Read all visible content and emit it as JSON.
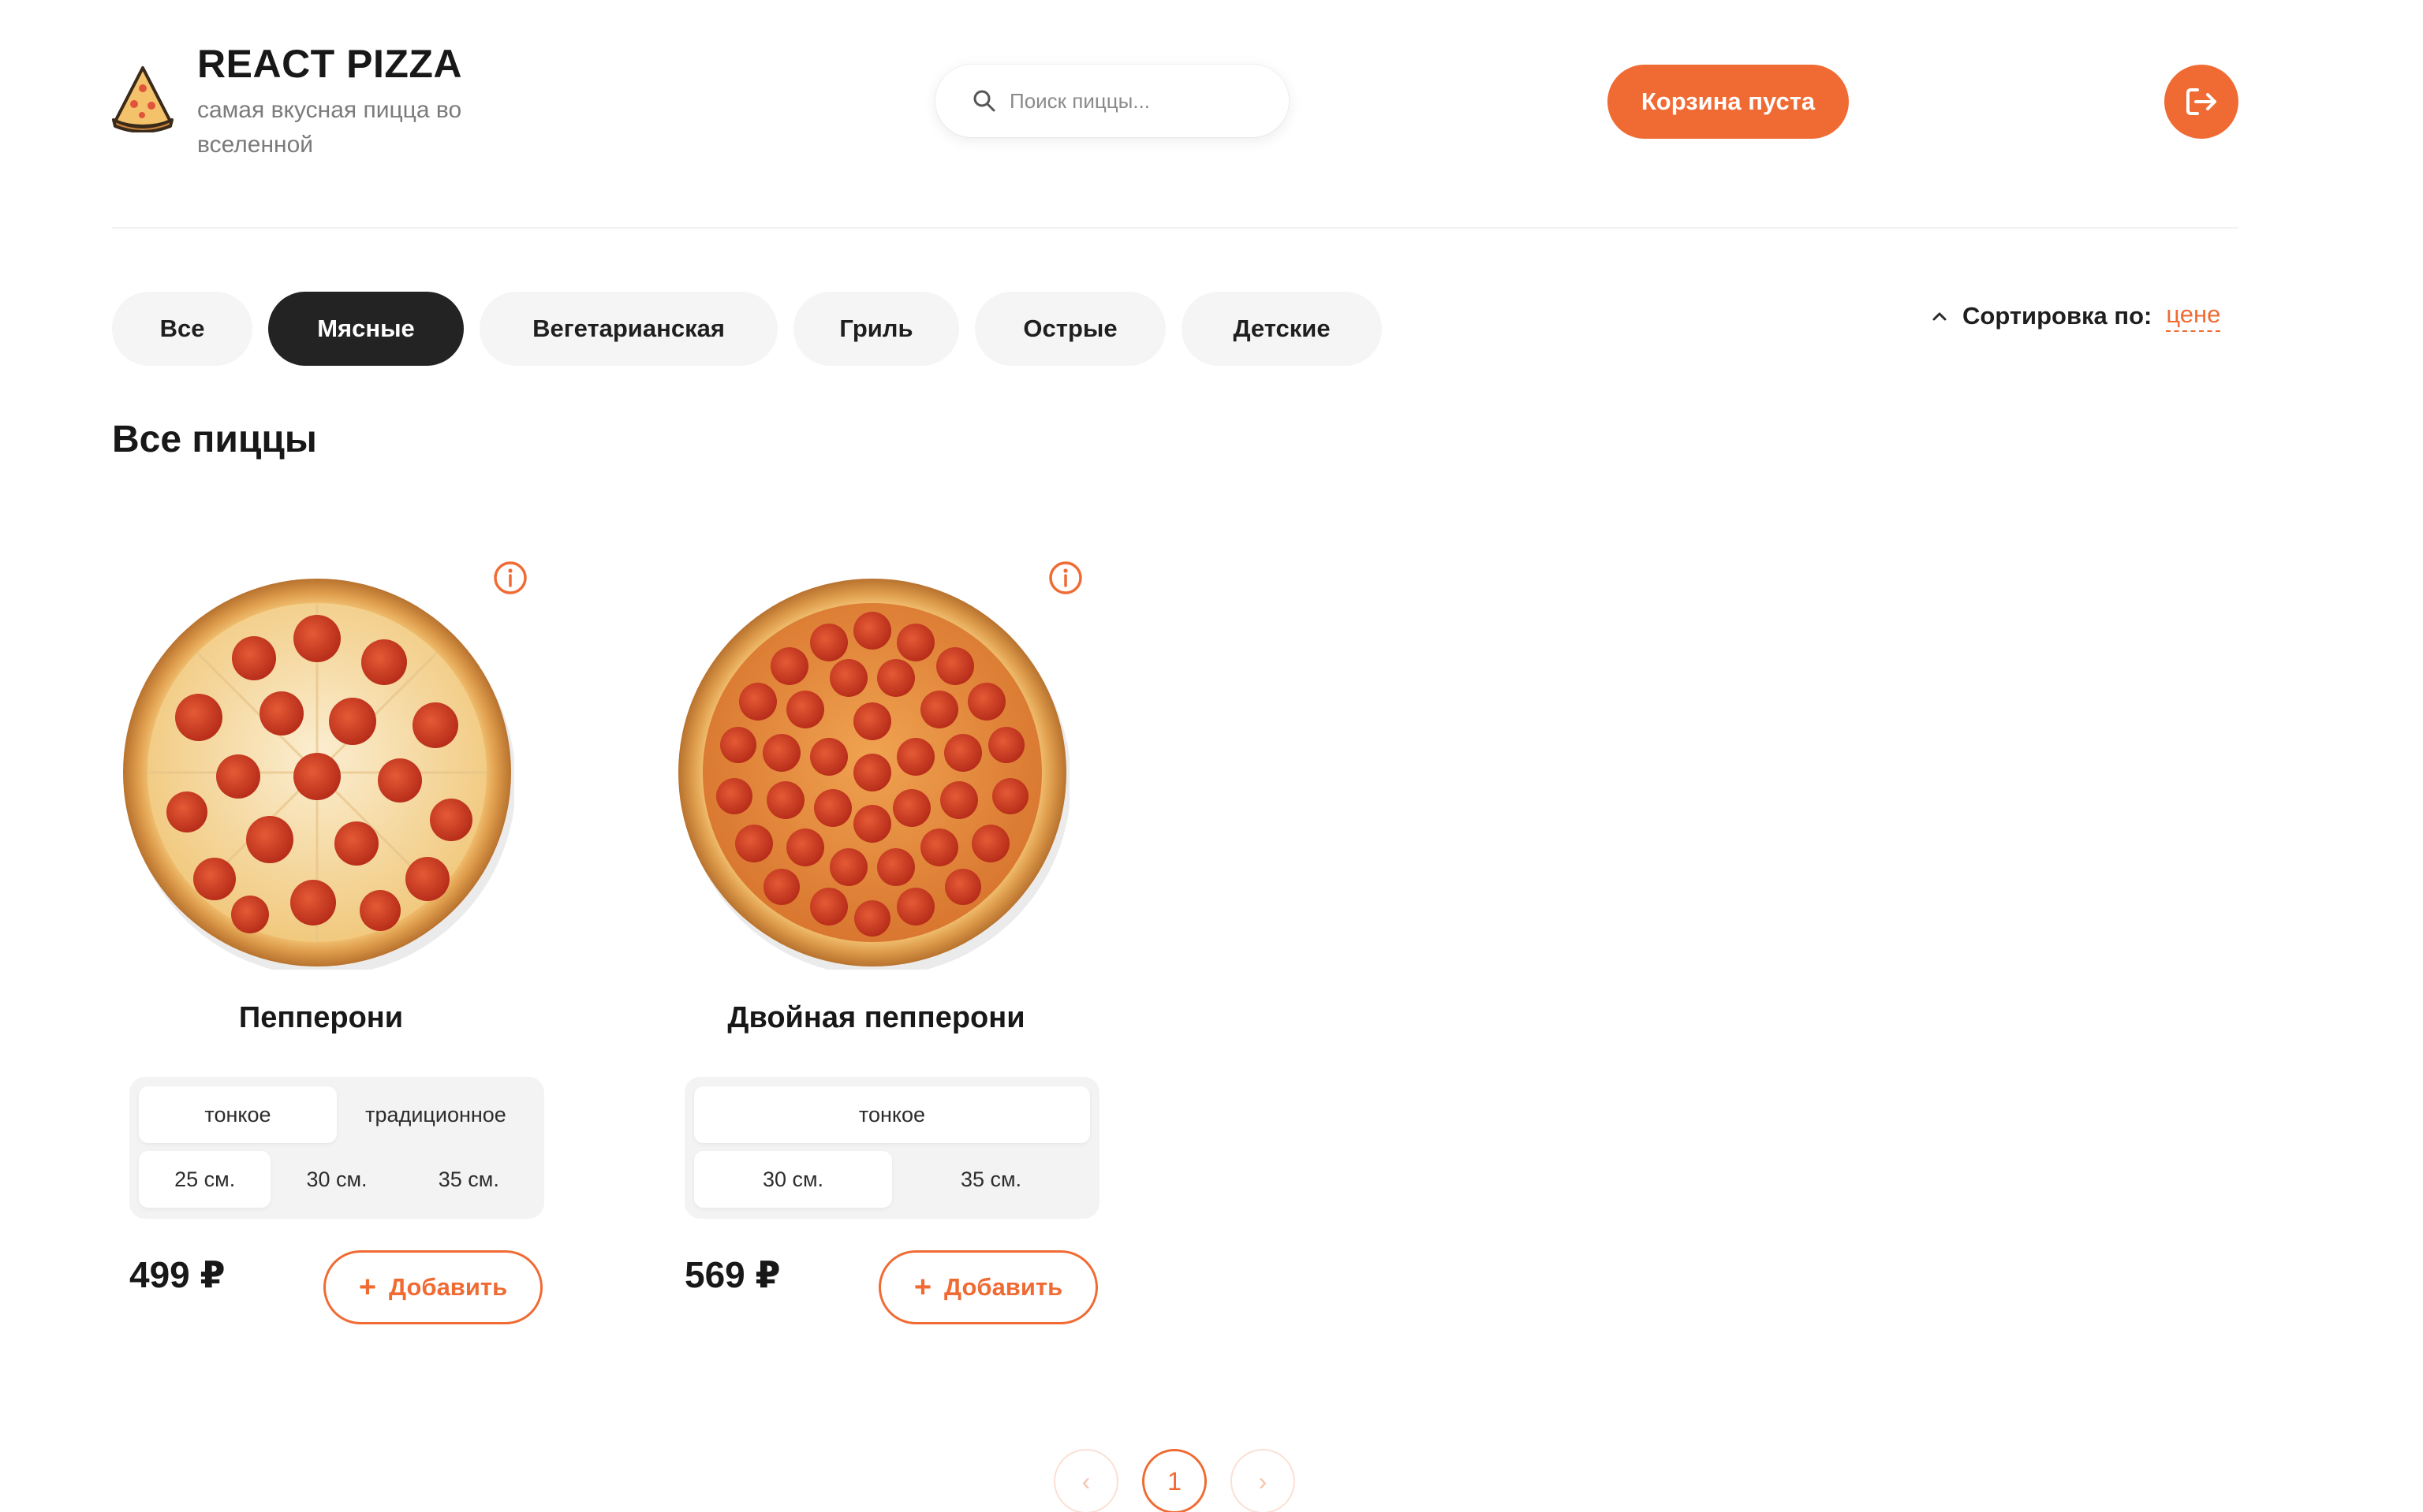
{
  "header": {
    "brand_title": "REACT PIZZA",
    "brand_subtitle": "самая вкусная пицца во вселенной",
    "search_placeholder": "Поиск пиццы...",
    "cart_label": "Корзина пуста",
    "logo_icon": "pizza-slice-icon",
    "logout_icon": "logout-icon"
  },
  "categories": [
    {
      "label": "Все",
      "active": false
    },
    {
      "label": "Мясные",
      "active": true
    },
    {
      "label": "Вегетарианская",
      "active": false
    },
    {
      "label": "Гриль",
      "active": false
    },
    {
      "label": "Острые",
      "active": false
    },
    {
      "label": "Детские",
      "active": false
    }
  ],
  "sort": {
    "label": "Сортировка по:",
    "value": "цене"
  },
  "page_title": "Все пиццы",
  "pizzas": [
    {
      "name": "Пепперони",
      "types": [
        {
          "label": "тонкое",
          "active": true
        },
        {
          "label": "традиционное",
          "active": false
        }
      ],
      "sizes": [
        {
          "label": "25 см.",
          "active": true
        },
        {
          "label": "30 см.",
          "active": false
        },
        {
          "label": "35 см.",
          "active": false
        }
      ],
      "price": "499 ₽",
      "add_label": "Добавить"
    },
    {
      "name": "Двойная пепперони",
      "types": [
        {
          "label": "тонкое",
          "active": true
        }
      ],
      "sizes": [
        {
          "label": "30 см.",
          "active": true
        },
        {
          "label": "35 см.",
          "active": false
        }
      ],
      "price": "569 ₽",
      "add_label": "Добавить"
    }
  ],
  "pagination": {
    "prev": "‹",
    "current": "1",
    "next": "›"
  },
  "colors": {
    "accent": "#f06b34",
    "dark": "#232323",
    "muted": "#f5f5f5"
  }
}
